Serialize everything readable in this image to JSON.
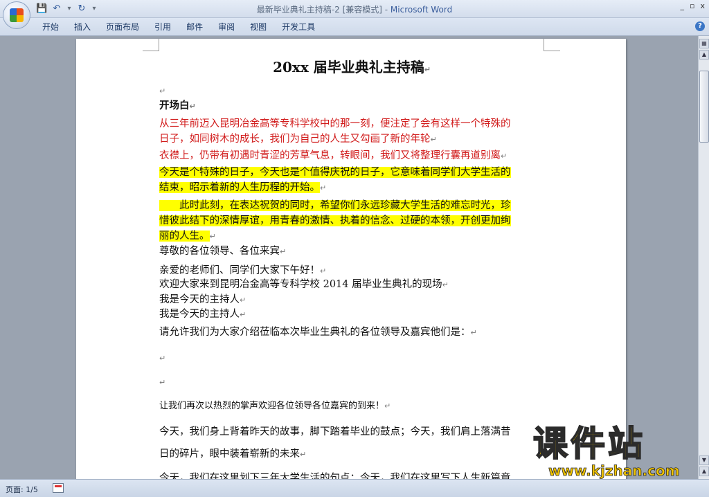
{
  "window": {
    "title": "最新毕业典礼主持稿-2 [兼容模式]",
    "app_separator": " - ",
    "app": "Microsoft Word",
    "controls": {
      "minimize": "_",
      "restore": "▫",
      "close": "x"
    }
  },
  "quick_access": {
    "save_icon": "save-icon",
    "undo_icon": "undo-icon",
    "redo_icon": "redo-icon"
  },
  "ribbon": {
    "tabs": [
      {
        "label": "开始"
      },
      {
        "label": "插入"
      },
      {
        "label": "页面布局"
      },
      {
        "label": "引用"
      },
      {
        "label": "邮件"
      },
      {
        "label": "审阅"
      },
      {
        "label": "视图"
      },
      {
        "label": "开发工具"
      }
    ],
    "help": "?"
  },
  "document": {
    "paragraph_mark": "↵",
    "title": "20xx 届毕业典礼主持稿",
    "heading_open": "开场白",
    "lines": [
      "从三年前迈入昆明冶金高等专科学校中的那一刻，便注定了会有这样一个特殊的",
      "日子，如同树木的成长，我们为自己的人生又勾画了新的年轮",
      "衣襟上，仍带有初遇时青涩的芳草气息，转眼间，我们又将整理行囊再道别离",
      "今天是个特殊的日子，今天也是个值得庆祝的日子，它意味着同学们大学生活的",
      "结束，昭示着新的人生历程的开始。",
      "　　此时此刻，在表达祝贺的同时，希望你们永远珍藏大学生活的难忘时光，珍",
      "惜彼此结下的深情厚谊，用青春的激情、执着的信念、过硬的本领，开创更加绚",
      "丽的人生。",
      "尊敬的各位领导、各位来宾",
      "亲爱的老师们、同学们大家下午好！",
      "欢迎大家来到昆明冶金高等专科学校 2014 届毕业生典礼的现场",
      "我是今天的主持人",
      "我是今天的主持人",
      "请允许我们为大家介绍莅临本次毕业生典礼的各位领导及嘉宾他们是：",
      "让我们再次以热烈的掌声欢迎各位领导各位嘉宾的到来！",
      "今天，我们身上背着昨天的故事，脚下踏着毕业的鼓点；今天，我们肩上落满昔",
      "日的碎片，眼中装着崭新的未来",
      "今天，我们在这里划下三年大学生活的句点；今天，我们在这里写下人生新篇章"
    ]
  },
  "status": {
    "pages": "页面: 1/5"
  },
  "watermark": {
    "text": "课件站",
    "url": "www.kjzhan.com"
  },
  "colors": {
    "red_text": "#d11a1a",
    "highlight": "#ffff00",
    "ribbon": "#dde6f3",
    "app_title": "#3a5d9c"
  }
}
